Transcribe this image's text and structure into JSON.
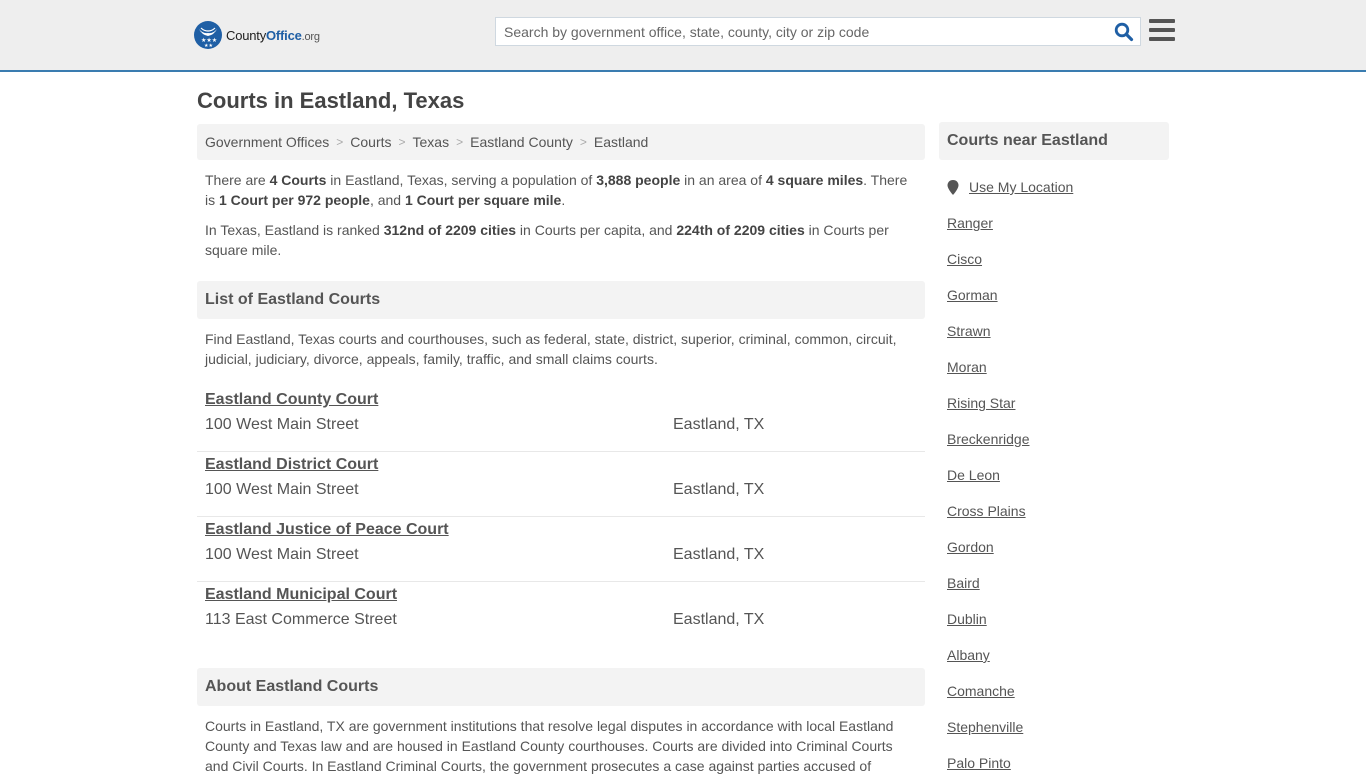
{
  "header": {
    "logo": {
      "text_main": "County",
      "text_accent": "Office",
      "text_tld": ".org"
    },
    "search": {
      "placeholder": "Search by government office, state, county, city or zip code",
      "value": ""
    },
    "icons": {
      "search": "search-icon",
      "menu": "hamburger-menu-icon"
    },
    "colors": {
      "brand": "#1f5fa5",
      "border": "#3a7cb0"
    }
  },
  "page": {
    "title": "Courts in Eastland, Texas"
  },
  "breadcrumb": [
    {
      "label": "Government Offices"
    },
    {
      "label": "Courts"
    },
    {
      "label": "Texas"
    },
    {
      "label": "Eastland County"
    },
    {
      "label": "Eastland"
    }
  ],
  "intro": {
    "p1": {
      "t1": "There are ",
      "b1": "4 Courts",
      "t2": " in Eastland, Texas, serving a population of ",
      "b2": "3,888 people",
      "t3": " in an area of ",
      "b3": "4 square miles",
      "t4": ". There is ",
      "b4": "1 Court per 972 people",
      "t5": ", and ",
      "b5": "1 Court per square mile",
      "t6": "."
    },
    "p2": {
      "t1": "In Texas, Eastland is ranked ",
      "b1": "312nd of 2209 cities",
      "t2": " in Courts per capita, and ",
      "b2": "224th of 2209 cities",
      "t3": " in Courts per square mile."
    }
  },
  "list_section": {
    "heading": "List of Eastland Courts",
    "description": "Find Eastland, Texas courts and courthouses, such as federal, state, district, superior, criminal, common, circuit, judicial, judiciary, divorce, appeals, family, traffic, and small claims courts.",
    "courts": [
      {
        "name": "Eastland County Court",
        "address": "100 West Main Street",
        "city": "Eastland, TX"
      },
      {
        "name": "Eastland District Court",
        "address": "100 West Main Street",
        "city": "Eastland, TX"
      },
      {
        "name": "Eastland Justice of Peace Court",
        "address": "100 West Main Street",
        "city": "Eastland, TX"
      },
      {
        "name": "Eastland Municipal Court",
        "address": "113 East Commerce Street",
        "city": "Eastland, TX"
      }
    ]
  },
  "about_section": {
    "heading": "About Eastland Courts",
    "text": "Courts in Eastland, TX are government institutions that resolve legal disputes in accordance with local Eastland County and Texas law and are housed in Eastland County courthouses. Courts are divided into Criminal Courts and Civil Courts. In Eastland Criminal Courts, the government prosecutes a case against parties accused of"
  },
  "sidebar": {
    "heading": "Courts near Eastland",
    "use_location": "Use My Location",
    "nearby": [
      "Ranger",
      "Cisco",
      "Gorman",
      "Strawn",
      "Moran",
      "Rising Star",
      "Breckenridge",
      "De Leon",
      "Cross Plains",
      "Gordon",
      "Baird",
      "Dublin",
      "Albany",
      "Comanche",
      "Stephenville",
      "Palo Pinto"
    ]
  }
}
